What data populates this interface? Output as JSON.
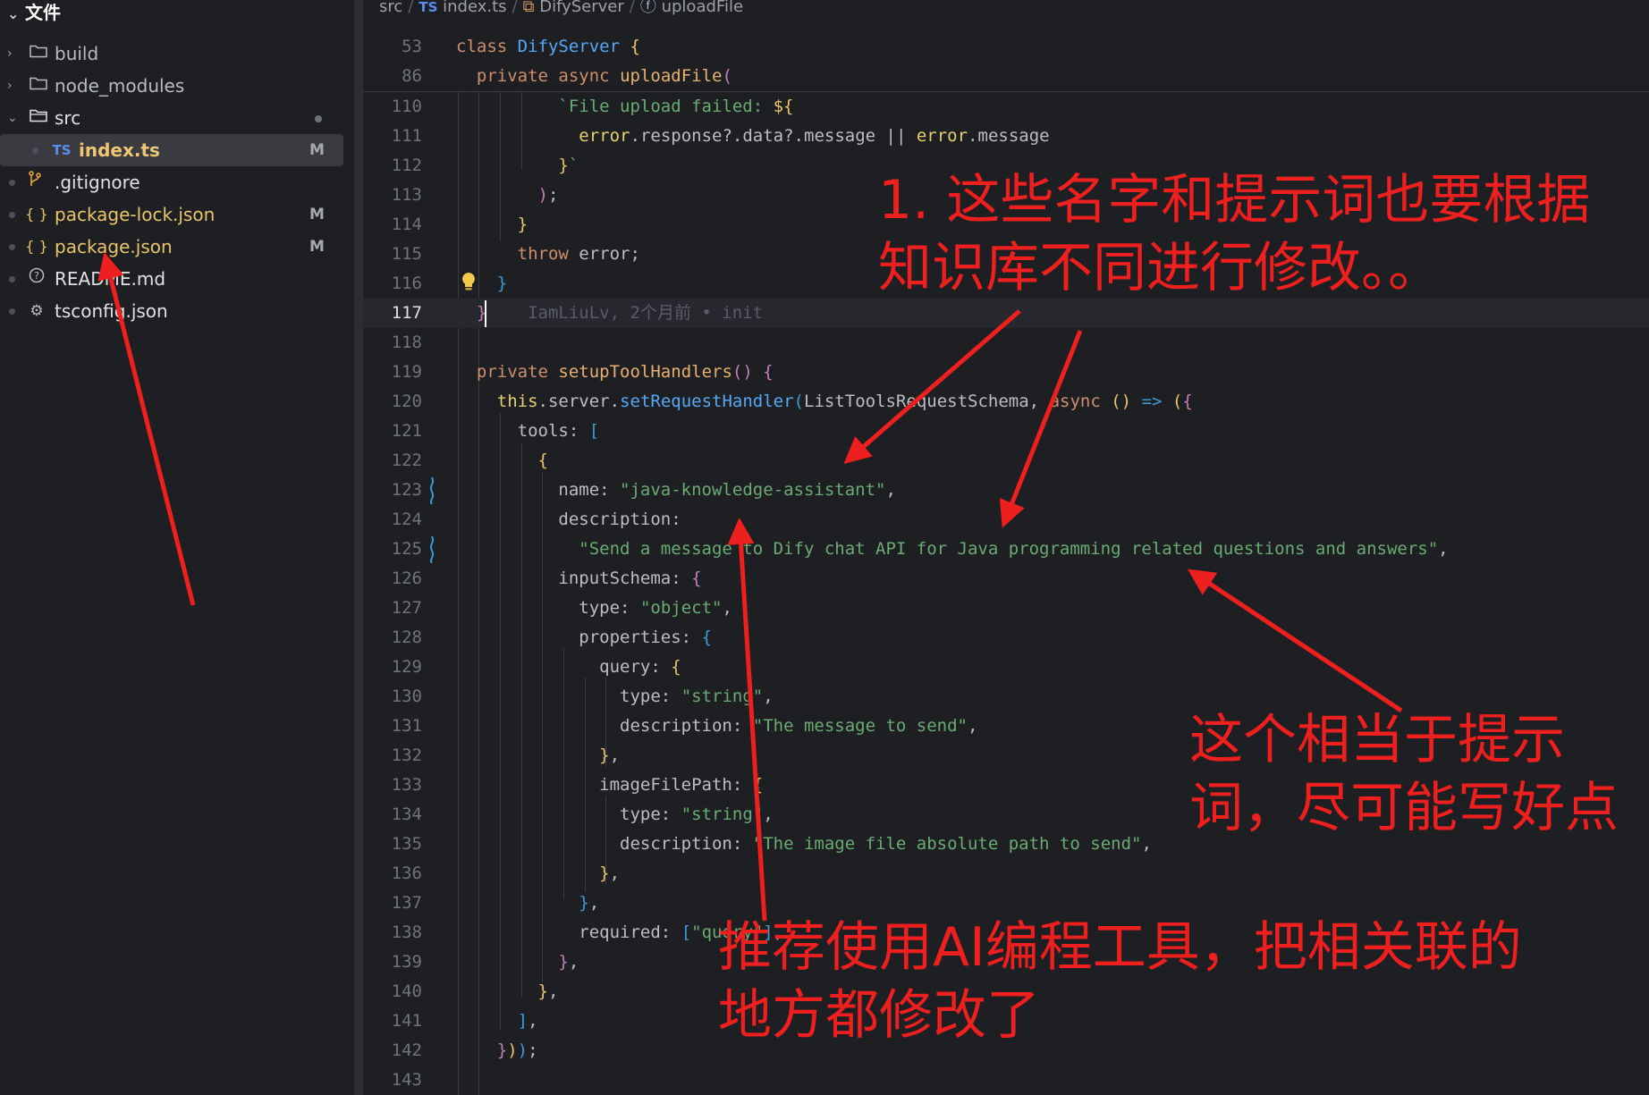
{
  "explorer": {
    "title": "文件",
    "items": [
      {
        "label": "build",
        "icon": "folder-icon",
        "expanded": false
      },
      {
        "label": "node_modules",
        "icon": "folder-icon",
        "expanded": false
      },
      {
        "label": "src",
        "icon": "folder-icon",
        "expanded": true
      },
      {
        "label": "index.ts",
        "icon": "typescript-file-icon",
        "badge": "M",
        "selected": true
      },
      {
        "label": ".gitignore",
        "icon": "git-icon"
      },
      {
        "label": "package-lock.json",
        "icon": "json-file-icon",
        "badge": "M"
      },
      {
        "label": "package.json",
        "icon": "json-file-icon",
        "badge": "M"
      },
      {
        "label": "README.md",
        "icon": "readme-file-icon"
      },
      {
        "label": "tsconfig.json",
        "icon": "gear-icon"
      }
    ],
    "ts_badge": "TS",
    "json_glyph": "{ }"
  },
  "breadcrumb": {
    "src": "src",
    "file_badge": "TS",
    "file": "index.ts",
    "class": "DifyServer",
    "method": "uploadFile"
  },
  "code": {
    "sticky": [
      {
        "ln": "53"
      },
      {
        "ln": "86"
      }
    ],
    "lines": [
      "110",
      "111",
      "112",
      "113",
      "114",
      "115",
      "116",
      "117",
      "118",
      "119",
      "120",
      "121",
      "122",
      "123",
      "124",
      "125",
      "126",
      "127",
      "128",
      "129",
      "130",
      "131",
      "132",
      "133",
      "134",
      "135",
      "136",
      "137",
      "138",
      "139",
      "140",
      "141",
      "142",
      "143"
    ],
    "blame": "IamLiuLv, 2个月前 • init"
  },
  "annotations": {
    "a1_line1": "1. 这些名字和提示词也要根据",
    "a1_line2": "知识库不同进行修改。。",
    "a2_line1": "这个相当于提示",
    "a2_line2": "词，尽可能写好点",
    "a3_line1": "推荐使用AI编程工具，把相关联的",
    "a3_line2": "地方都修改了"
  },
  "colors": {
    "annotation": "#ee1f1f",
    "background": "#1e1f22",
    "keyword": "#cf8e6d",
    "string": "#6aab73",
    "function": "#56a8f5"
  }
}
